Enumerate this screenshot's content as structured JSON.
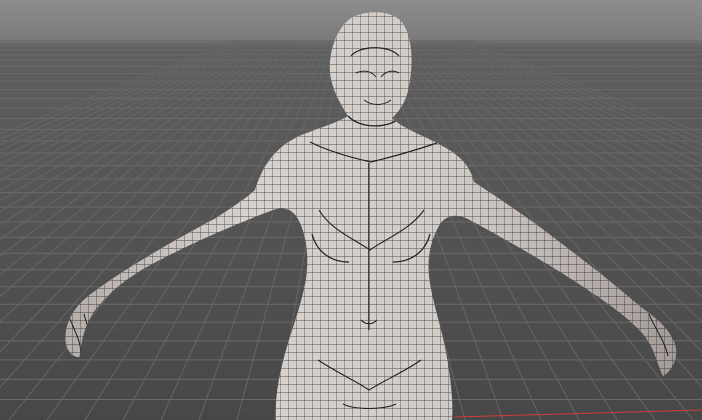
{
  "viewport": {
    "background_top": "#8a8a8a",
    "background_floor": "#4b4b4b",
    "grid_color": "#6b6b6b",
    "axis_x_color": "#d23b3b"
  },
  "model": {
    "name": "female-base-mesh-wireframe",
    "skin_color": "#d7d1cd",
    "wire_color": "#1f1f1f"
  }
}
